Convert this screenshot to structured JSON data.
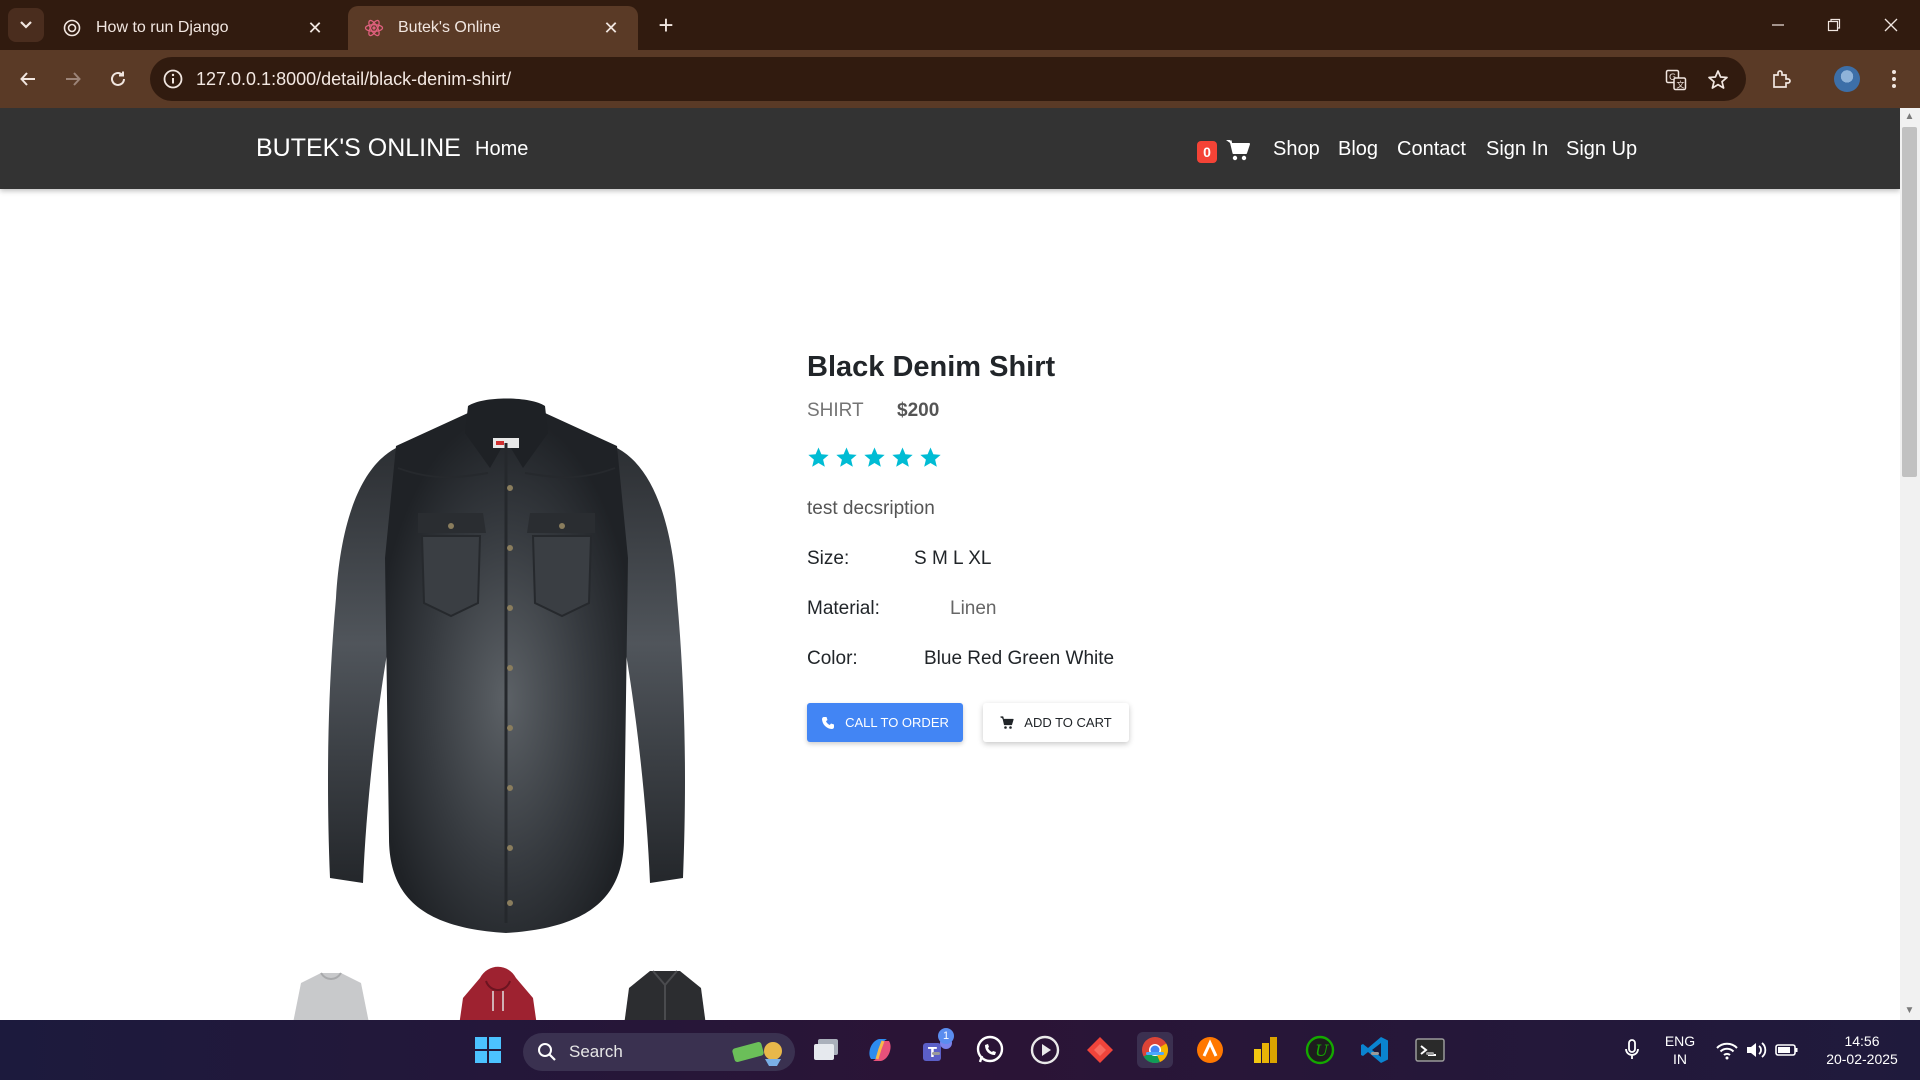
{
  "browser": {
    "tabs": [
      {
        "title": "How to run Django",
        "active": false,
        "favicon": "openai-icon"
      },
      {
        "title": "Butek's Online",
        "active": true,
        "favicon": "react-icon"
      }
    ],
    "url": "127.0.0.1:8000/detail/black-denim-shirt/"
  },
  "site": {
    "brand": "BUTEK'S ONLINE",
    "home": "Home",
    "cart_count": "0",
    "links": [
      "Shop",
      "Blog",
      "Contact",
      "Sign In",
      "Sign Up"
    ]
  },
  "product": {
    "title": "Black Denim Shirt",
    "category": "SHIRT",
    "price": "$200",
    "rating": 5,
    "rating_color": "#00bcd4",
    "description": "test decsription",
    "size_label": "Size:",
    "size_value": "S M L XL",
    "material_label": "Material:",
    "material_value": "Linen",
    "color_label": "Color:",
    "color_value": "Blue Red Green White",
    "call_button": "CALL TO ORDER",
    "cart_button": "ADD TO CART"
  },
  "taskbar": {
    "search": "Search",
    "lang_top": "ENG",
    "lang_bottom": "IN",
    "time": "14:56",
    "date": "20-02-2025",
    "teams_badge": "1"
  },
  "colors": {
    "chrome_dark": "#311b0f",
    "chrome_mid": "#5a3a26",
    "navbar": "#333333",
    "primary_button": "#4285f4",
    "badge": "#f44336"
  }
}
